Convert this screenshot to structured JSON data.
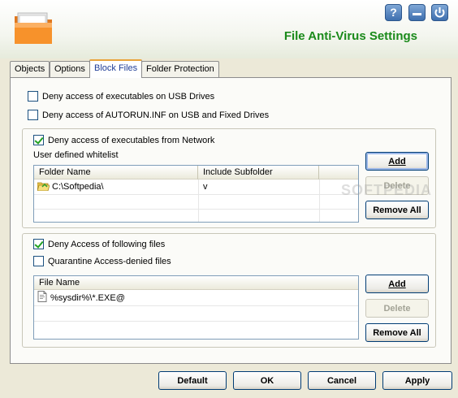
{
  "window": {
    "title": "File Anti-Virus Settings",
    "controls": {
      "help": "?",
      "minimize": "_",
      "power": "power"
    }
  },
  "tabs": [
    {
      "label": "Objects",
      "active": false
    },
    {
      "label": "Options",
      "active": false
    },
    {
      "label": "Block Files",
      "active": true
    },
    {
      "label": "Folder Protection",
      "active": false
    }
  ],
  "block_files": {
    "usb_exec": {
      "label": "Deny access of executables on USB Drives",
      "checked": false
    },
    "autorun": {
      "label": "Deny access of AUTORUN.INF on USB and Fixed Drives",
      "checked": false
    },
    "network": {
      "label": "Deny access of executables from Network",
      "checked": true,
      "whitelist_label": "User defined whitelist",
      "columns": [
        "Folder Name",
        "Include Subfolder"
      ],
      "rows": [
        {
          "folder": "C:\\Softpedia\\",
          "include_subfolder": "v"
        }
      ],
      "buttons": {
        "add": "Add",
        "delete": "Delete",
        "remove_all": "Remove All"
      }
    },
    "following_files": {
      "label": "Deny Access of following files",
      "checked": true,
      "quarantine": {
        "label": "Quarantine Access-denied files",
        "checked": false
      },
      "columns": [
        "File Name"
      ],
      "rows": [
        {
          "file": "%sysdir%\\*.EXE@"
        }
      ],
      "buttons": {
        "add": "Add",
        "delete": "Delete",
        "remove_all": "Remove All"
      }
    }
  },
  "footer": {
    "default": "Default",
    "ok": "OK",
    "cancel": "Cancel",
    "apply": "Apply"
  },
  "watermark": "SOFTPEDIA",
  "colors": {
    "title_green": "#1a8a1a",
    "active_tab_text": "#1f3d96",
    "checkmark": "#21a121",
    "window_bg": "#ece9d8"
  },
  "icons": [
    "folder-app-icon",
    "help-icon",
    "minimize-icon",
    "power-icon",
    "checkmark-icon",
    "folder-icon",
    "file-icon"
  ]
}
